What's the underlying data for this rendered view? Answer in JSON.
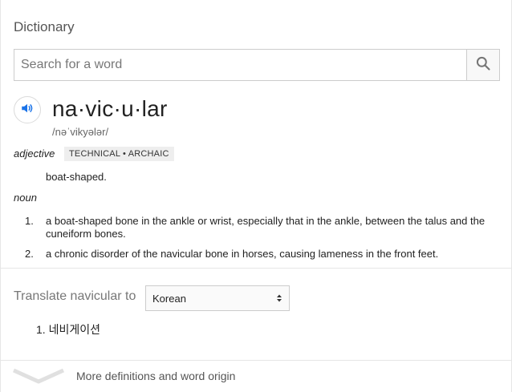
{
  "header": {
    "title": "Dictionary"
  },
  "search": {
    "placeholder": "Search for a word",
    "value": ""
  },
  "entry": {
    "headword": "na·vic·u·lar",
    "pronunciation": "/nəˈvikyələr/",
    "senses": [
      {
        "pos": "adjective",
        "label": "TECHNICAL • ARCHAIC",
        "definitions": [
          "boat-shaped."
        ]
      },
      {
        "pos": "noun",
        "definitions": [
          {
            "num": "1.",
            "text": "a boat-shaped bone in the ankle or wrist, especially that in the ankle, between the talus and the cuneiform bones."
          },
          {
            "num": "2.",
            "text": "a chronic disorder of the navicular bone in horses, causing lameness in the front feet."
          }
        ]
      }
    ]
  },
  "translate": {
    "label": "Translate navicular to",
    "selected_language": "Korean",
    "results": [
      {
        "num": "1.",
        "text": "네비게이션"
      }
    ]
  },
  "footer": {
    "more_label": "More definitions and word origin"
  },
  "icons": {
    "search": "search-icon",
    "speaker": "speaker-icon",
    "expand": "chevron-down-icon",
    "select_arrows": "select-arrows-icon"
  },
  "colors": {
    "speaker_blue": "#1a73e8",
    "icon_gray": "#757575"
  }
}
